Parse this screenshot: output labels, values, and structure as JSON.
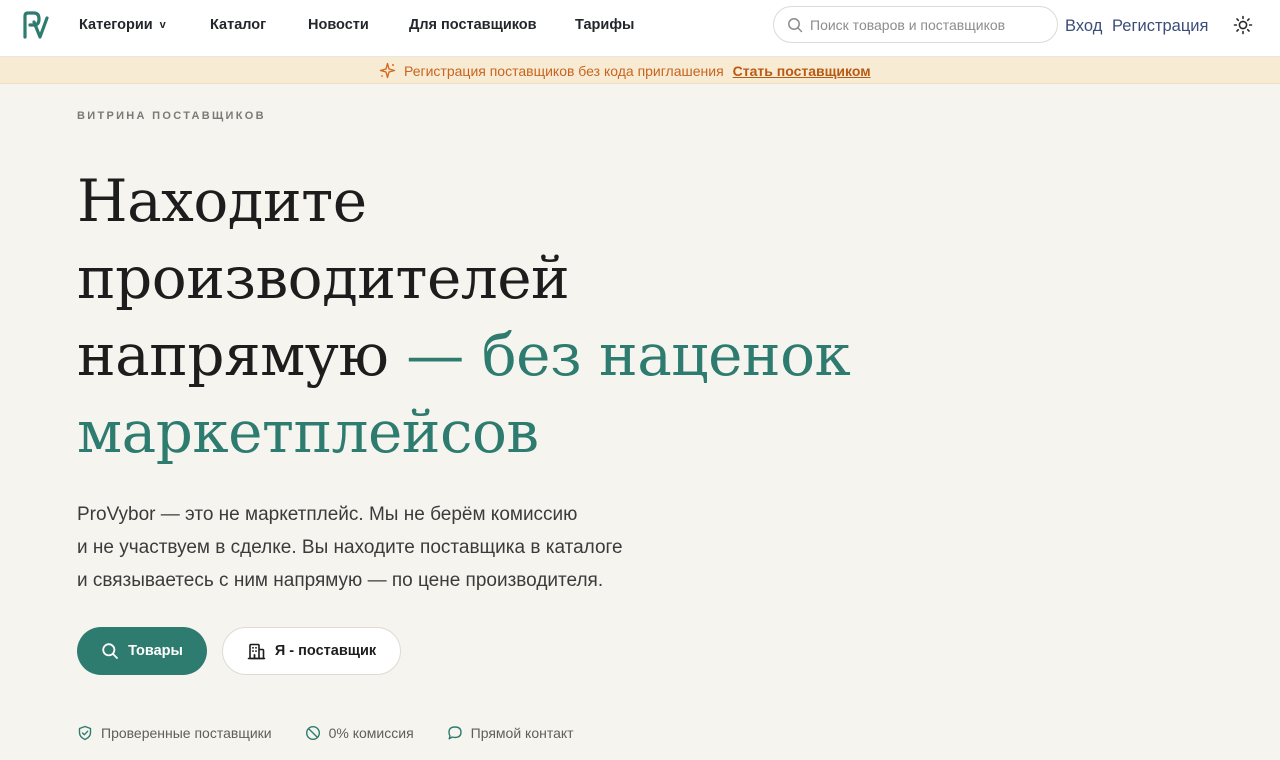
{
  "header": {
    "logo_icon": "provybor-logo-icon",
    "nav": {
      "categories": "Категории",
      "categories_chevron": "v",
      "catalog": "Каталог",
      "news": "Новости",
      "for_suppliers": "Для поставщиков",
      "tariffs": "Тарифы"
    },
    "search": {
      "icon": "search-icon",
      "placeholder": "Поиск товаров и поставщиков",
      "value": ""
    },
    "login": "Вход",
    "register": "Регистрация",
    "theme_icon": "sun-icon"
  },
  "banner": {
    "icon": "sparkle-icon",
    "text": "Регистрация поставщиков без кода приглашения",
    "link": "Стать поставщиком"
  },
  "hero": {
    "eyebrow": "ВИТРИНА ПОСТАВЩИКОВ",
    "title_line1": "Находите",
    "title_line2": "производителей",
    "title_line3_plain": "напрямую",
    "title_line3_accent": "— без наценок",
    "title_line4_accent": "маркетплейсов",
    "description_line1": "ProVybor — это не маркетплейс. Мы не берём комиссию",
    "description_line2": "и не участвуем в сделке. Вы находите поставщика в каталоге",
    "description_line3": "и связываетесь с ним напрямую — по цене производителя.",
    "btn_products": "Товары",
    "btn_supplier": "Я - поставщик"
  },
  "features": [
    {
      "icon": "shield-check-icon",
      "label": "Проверенные поставщики"
    },
    {
      "icon": "no-commission-icon",
      "label": "0% комиссия"
    },
    {
      "icon": "chat-bubble-icon",
      "label": "Прямой контакт"
    }
  ],
  "colors": {
    "accent": "#2e7b6f",
    "banner_bg": "#f8ebd4",
    "banner_text": "#c8641f",
    "page_bg": "#f6f4ef"
  }
}
